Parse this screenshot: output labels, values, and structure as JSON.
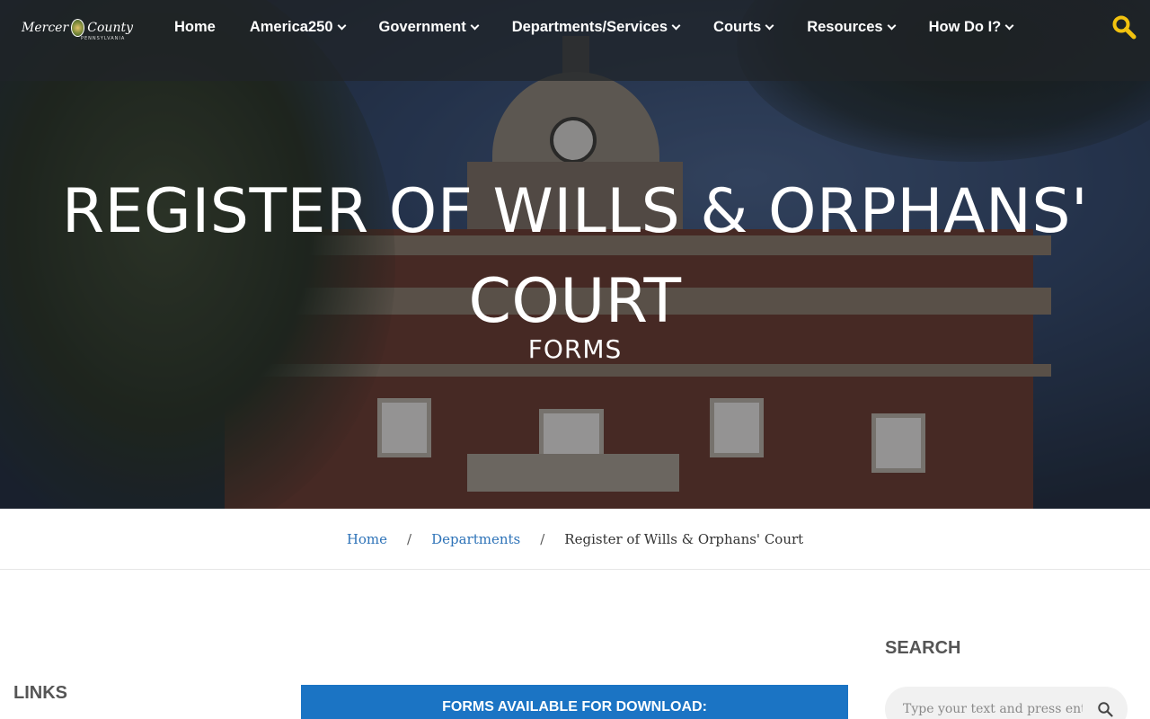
{
  "header": {
    "logo_text_left": "Mercer",
    "logo_text_right": "County",
    "logo_subtext": "PENNSYLVANIA",
    "nav": [
      {
        "label": "Home",
        "has_dropdown": false
      },
      {
        "label": "America250",
        "has_dropdown": true
      },
      {
        "label": "Government",
        "has_dropdown": true
      },
      {
        "label": "Departments/Services",
        "has_dropdown": true
      },
      {
        "label": "Courts",
        "has_dropdown": true
      },
      {
        "label": "Resources",
        "has_dropdown": true
      },
      {
        "label": "How Do I?",
        "has_dropdown": true
      }
    ],
    "search_icon": "search-icon",
    "search_icon_color": "#f2c20f"
  },
  "hero": {
    "title_line1": "REGISTER OF WILLS & ORPHANS'",
    "title_line2": "COURT",
    "subtitle": "FORMS"
  },
  "breadcrumb": {
    "home": "Home",
    "sep1": "/",
    "departments": "Departments",
    "sep2": "/",
    "current": "Register of Wills & Orphans' Court"
  },
  "content": {
    "links_heading": "LINKS",
    "forms_banner": "FORMS AVAILABLE FOR DOWNLOAD:",
    "forms_banner_color": "#1b74c4"
  },
  "sidebar": {
    "search_heading": "SEARCH",
    "search_placeholder": "Type your text and press enter",
    "search_icon": "search-icon"
  },
  "colors": {
    "link": "#2e73b8",
    "accent_yellow": "#f2c20f"
  }
}
